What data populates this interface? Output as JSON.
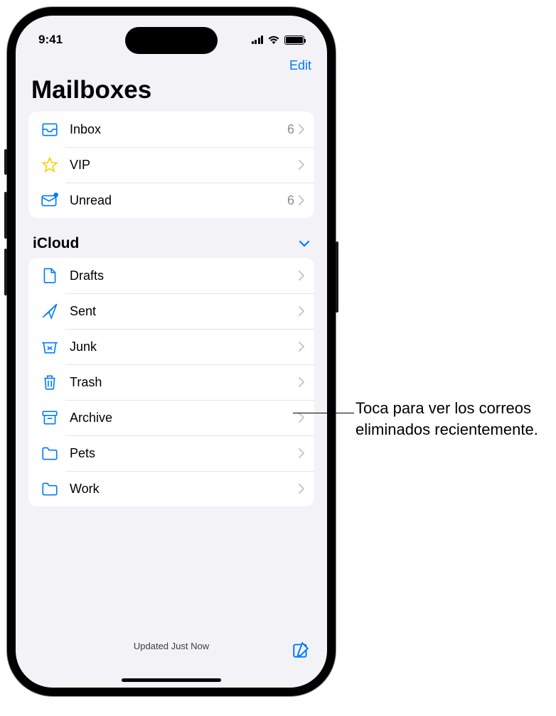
{
  "status_bar": {
    "time": "9:41"
  },
  "nav": {
    "edit_label": "Edit"
  },
  "page_title": "Mailboxes",
  "favorites": [
    {
      "id": "inbox",
      "label": "Inbox",
      "count": "6",
      "icon": "inbox-icon"
    },
    {
      "id": "vip",
      "label": "VIP",
      "count": "",
      "icon": "star-icon"
    },
    {
      "id": "unread",
      "label": "Unread",
      "count": "6",
      "icon": "unread-icon"
    }
  ],
  "accounts": [
    {
      "name": "iCloud",
      "folders": [
        {
          "id": "drafts",
          "label": "Drafts",
          "icon": "drafts-icon"
        },
        {
          "id": "sent",
          "label": "Sent",
          "icon": "sent-icon"
        },
        {
          "id": "junk",
          "label": "Junk",
          "icon": "junk-icon"
        },
        {
          "id": "trash",
          "label": "Trash",
          "icon": "trash-icon"
        },
        {
          "id": "archive",
          "label": "Archive",
          "icon": "archive-icon"
        },
        {
          "id": "pets",
          "label": "Pets",
          "icon": "folder-icon"
        },
        {
          "id": "work",
          "label": "Work",
          "icon": "folder-icon"
        }
      ]
    }
  ],
  "toolbar": {
    "status_text": "Updated Just Now"
  },
  "callout": {
    "text": "Toca para ver los correos eliminados recientemente."
  }
}
